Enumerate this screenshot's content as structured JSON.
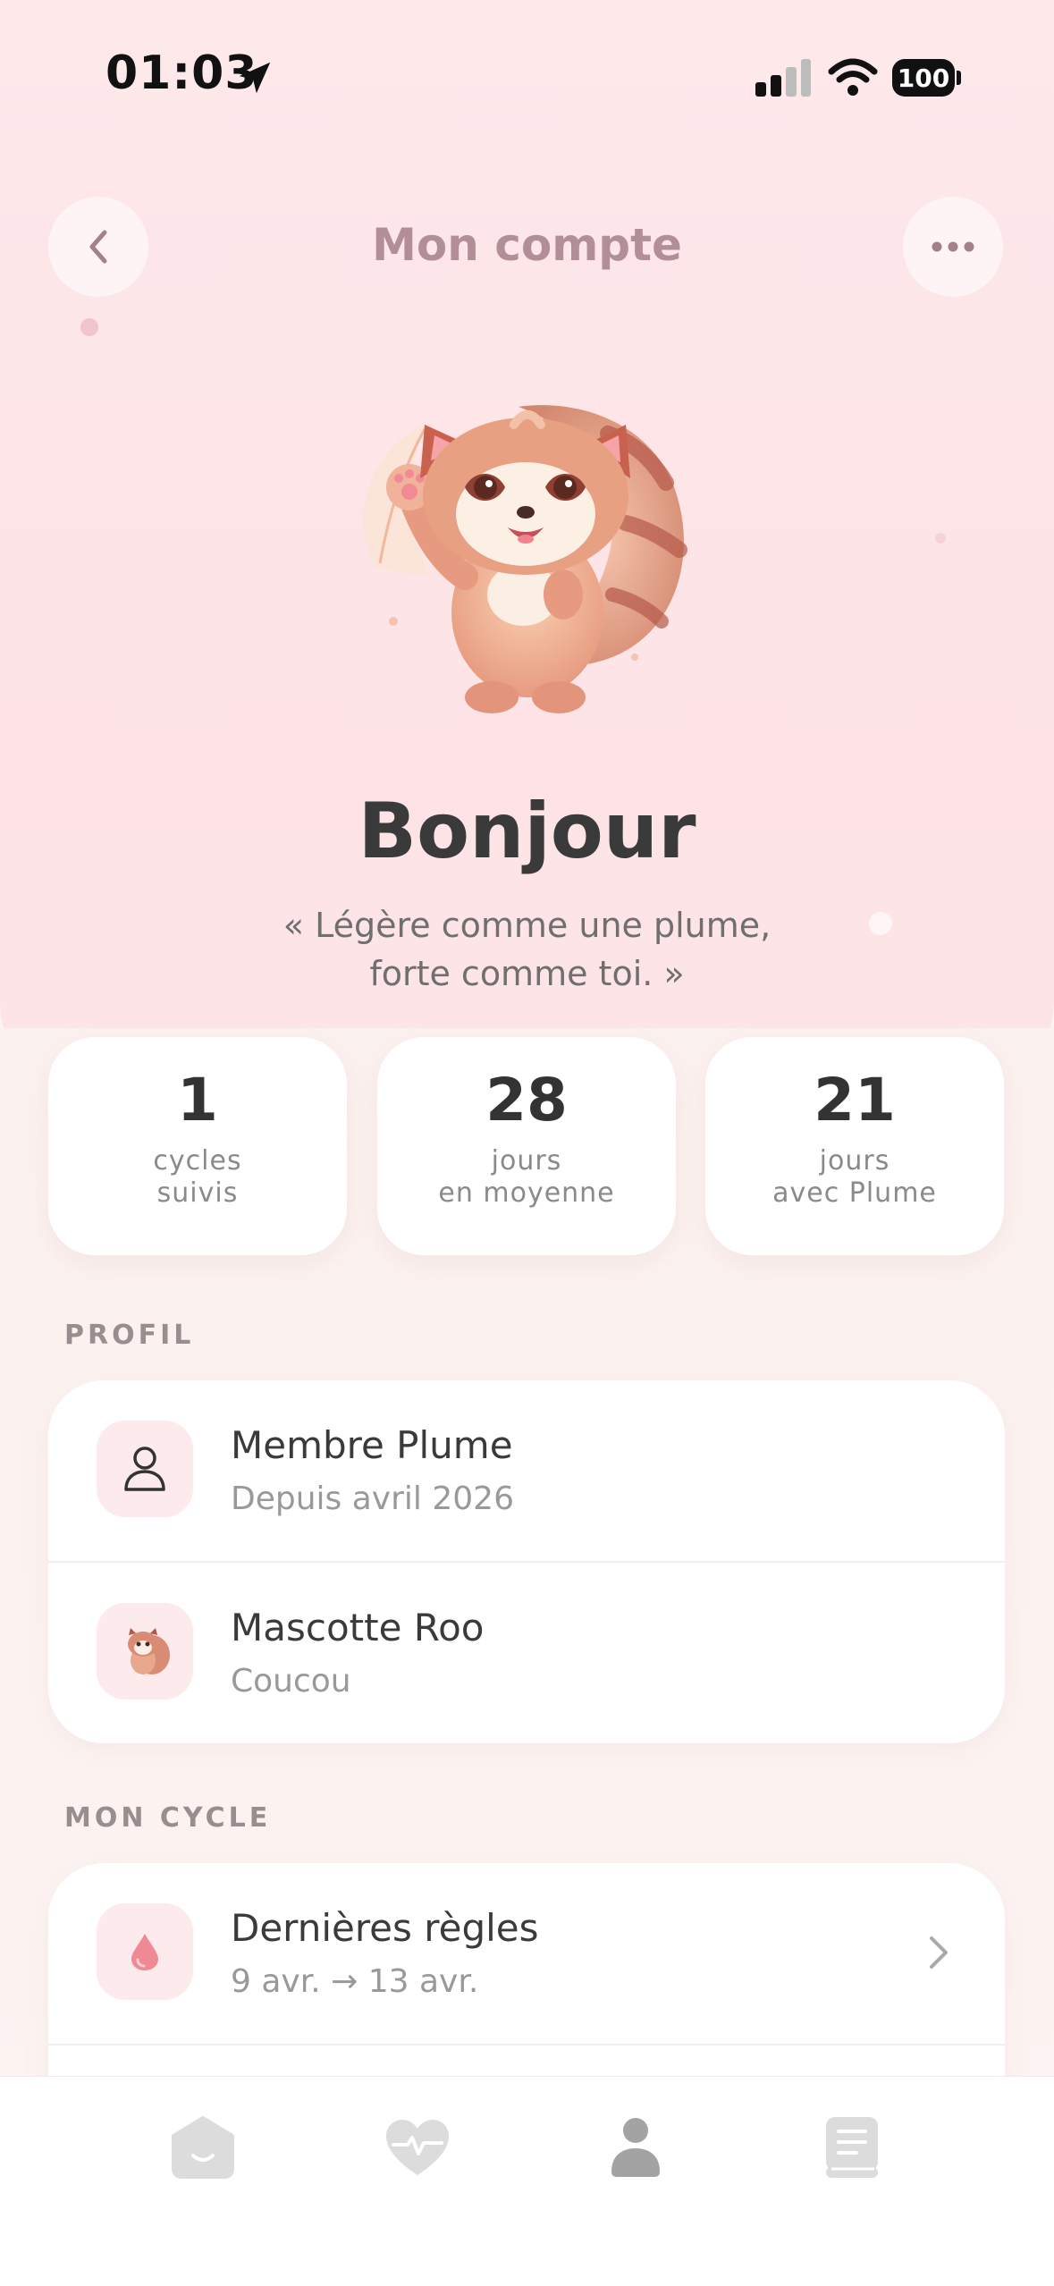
{
  "status_bar": {
    "time": "01:03",
    "battery": "100"
  },
  "header": {
    "title": "Mon compte"
  },
  "greeting": "Bonjour",
  "quote": {
    "line1": "« Légère comme une plume,",
    "line2": "forte comme toi. »"
  },
  "stats": [
    {
      "value": "1",
      "label1": "cycles",
      "label2": "suivis"
    },
    {
      "value": "28",
      "label1": "jours",
      "label2": "en moyenne"
    },
    {
      "value": "21",
      "label1": "jours",
      "label2": "avec Plume"
    }
  ],
  "profile": {
    "section_label": "PROFIL",
    "items": [
      {
        "title": "Membre Plume",
        "subtitle": "Depuis avril 2026",
        "icon": "user-icon"
      },
      {
        "title": "Mascotte Roo",
        "subtitle": "Coucou",
        "icon": "red-panda-icon"
      }
    ]
  },
  "cycle": {
    "section_label": "MON CYCLE",
    "items": [
      {
        "title": "Dernières règles",
        "subtitle": "9 avr. → 13 avr.",
        "icon": "drop-icon"
      }
    ]
  },
  "tabbar": {
    "tabs": [
      "home-icon",
      "heart-pulse-icon",
      "profile-icon",
      "book-icon"
    ],
    "active": "profile-icon"
  },
  "colors": {
    "accent_pink": "#fdeaec",
    "title_mauve": "#b28e98",
    "drop_red": "#ef8a95"
  }
}
